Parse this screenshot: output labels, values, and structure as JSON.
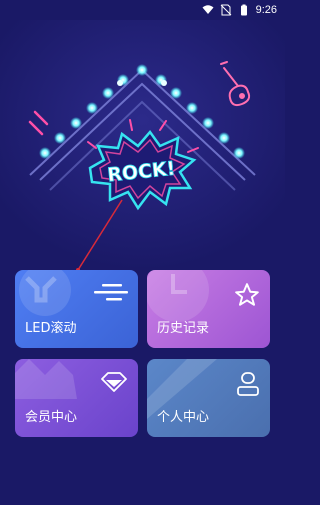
{
  "status_bar": {
    "time": "9:26",
    "icons": [
      "wifi-icon",
      "no-sim-icon",
      "battery-icon"
    ]
  },
  "hero": {
    "sign_text": "ROCK!",
    "decor_icons": [
      "guitar-icon",
      "marquee-lights"
    ]
  },
  "menu": {
    "led": {
      "label": "LED滚动",
      "icon": "lines-icon"
    },
    "history": {
      "label": "历史记录",
      "icon": "star-icon"
    },
    "vip": {
      "label": "会员中心",
      "icon": "diamond-icon"
    },
    "personal": {
      "label": "个人中心",
      "icon": "user-icon"
    }
  },
  "colors": {
    "background": "#1a1966",
    "led_card": "#4f7ef3",
    "history_card": "#c87de4",
    "vip_card": "#8d5ee0",
    "personal_card": "#5b87c9",
    "neon_cyan": "#36e3f0",
    "neon_pink": "#ff4fa8"
  }
}
